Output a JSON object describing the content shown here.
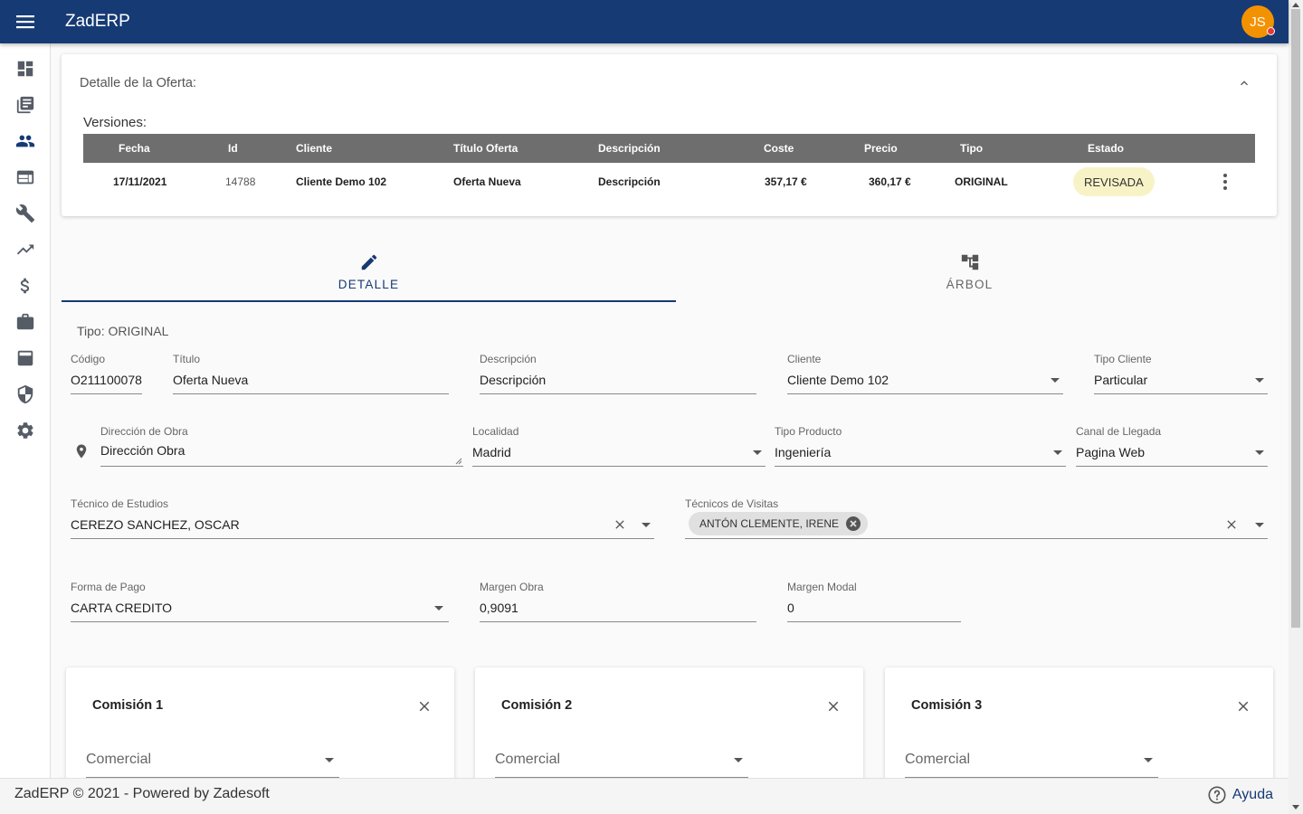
{
  "app": {
    "title": "ZadERP",
    "user_initials": "JS"
  },
  "sidebar": {
    "items": [
      {
        "icon": "dashboard-icon"
      },
      {
        "icon": "library-icon"
      },
      {
        "icon": "people-icon",
        "active": true
      },
      {
        "icon": "web-icon"
      },
      {
        "icon": "wrench-icon"
      },
      {
        "icon": "trending-icon"
      },
      {
        "icon": "dollar-icon"
      },
      {
        "icon": "briefcase-icon"
      },
      {
        "icon": "upload-box-icon"
      },
      {
        "icon": "shield-icon"
      },
      {
        "icon": "gear-icon"
      }
    ]
  },
  "offer_card": {
    "heading": "Detalle de la Oferta:",
    "versions_label": "Versiones:",
    "columns": [
      "Fecha",
      "Id",
      "Cliente",
      "Título Oferta",
      "Descripción",
      "Coste",
      "Precio",
      "Tipo",
      "Estado"
    ],
    "rows": [
      {
        "fecha": "17/11/2021",
        "id": "14788",
        "cliente": "Cliente Demo 102",
        "titulo": "Oferta Nueva",
        "descripcion": "Descripción",
        "coste": "357,17 €",
        "precio": "360,17 €",
        "tipo": "ORIGINAL",
        "estado": "REVISADA"
      }
    ]
  },
  "tabs": [
    {
      "label": "DETALLE",
      "icon": "pencil-icon",
      "active": true
    },
    {
      "label": "ÁRBOL",
      "icon": "tree-icon",
      "active": false
    }
  ],
  "form": {
    "tipo": "Tipo: ORIGINAL",
    "codigo": {
      "label": "Código",
      "value": "O211100078"
    },
    "titulo": {
      "label": "Título",
      "value": "Oferta Nueva"
    },
    "descripcion": {
      "label": "Descripción",
      "value": "Descripción"
    },
    "cliente": {
      "label": "Cliente",
      "value": "Cliente Demo 102"
    },
    "tipo_cliente": {
      "label": "Tipo Cliente",
      "value": "Particular"
    },
    "direccion": {
      "label": "Dirección de Obra",
      "value": "Dirección Obra"
    },
    "localidad": {
      "label": "Localidad",
      "value": "Madrid"
    },
    "tipo_producto": {
      "label": "Tipo Producto",
      "value": "Ingeniería"
    },
    "canal": {
      "label": "Canal de Llegada",
      "value": "Pagina Web"
    },
    "tecnico_estudios": {
      "label": "Técnico de Estudios",
      "value": "CEREZO SANCHEZ, OSCAR"
    },
    "tecnicos_visitas": {
      "label": "Técnicos de Visitas",
      "chips": [
        "ANTÓN CLEMENTE, IRENE"
      ]
    },
    "forma_pago": {
      "label": "Forma de Pago",
      "value": "CARTA CREDITO"
    },
    "margen_obra": {
      "label": "Margen Obra",
      "value": "0,9091"
    },
    "margen_modal": {
      "label": "Margen Modal",
      "value": "0"
    }
  },
  "commissions": [
    {
      "title": "Comisión 1",
      "field_placeholder": "Comercial"
    },
    {
      "title": "Comisión 2",
      "field_placeholder": "Comercial"
    },
    {
      "title": "Comisión 3",
      "field_placeholder": "Comercial"
    }
  ],
  "footer": {
    "text": "ZadERP © 2021 - Powered by Zadesoft",
    "help_label": "Ayuda"
  },
  "colors": {
    "primary": "#163a74",
    "accent": "#f39200",
    "status_bg": "#f8f3c7",
    "table_header": "#6e6e6e"
  }
}
